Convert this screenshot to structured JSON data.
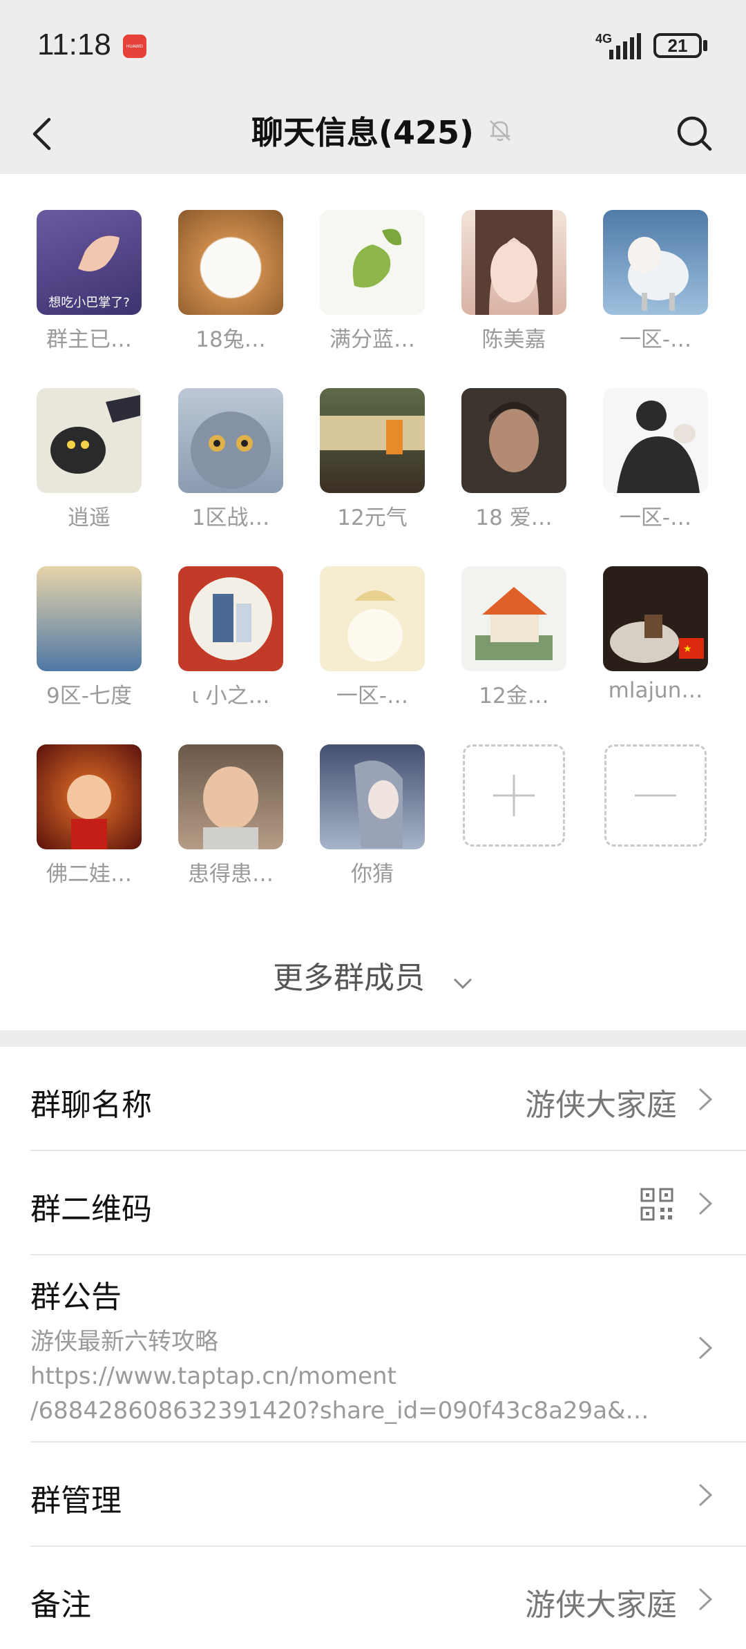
{
  "status_bar": {
    "time": "11:18",
    "app_badge": "HUAWEI",
    "network": "4G",
    "battery": "21"
  },
  "nav": {
    "title": "聊天信息(425)",
    "back_icon": "chevron-left-icon",
    "mute_icon": "bell-off-icon",
    "search_icon": "search-icon"
  },
  "members": [
    {
      "name": "群主已…",
      "avatar_color": "#5b4a8a",
      "avatar_caption": "想吃小巴掌了?"
    },
    {
      "name": "18兔…",
      "avatar_color": "#c4884a"
    },
    {
      "name": "满分蓝…",
      "avatar_color": "#f7f7f2"
    },
    {
      "name": "陈美嘉",
      "avatar_color": "#e9cfc4"
    },
    {
      "name": "一区-…",
      "avatar_color": "#7fa6c7"
    },
    {
      "name": "逍遥",
      "avatar_color": "#d9d4c6"
    },
    {
      "name": "1区战…",
      "avatar_color": "#8b9bb0"
    },
    {
      "name": "12元气",
      "avatar_color": "#6a5a40"
    },
    {
      "name": "18 爱…",
      "avatar_color": "#3c342e"
    },
    {
      "name": "一区-…",
      "avatar_color": "#f2f2f2"
    },
    {
      "name": "9区-七度",
      "avatar_color": "#b9c8d4"
    },
    {
      "name": "ι 小之…",
      "avatar_color": "#c23a28"
    },
    {
      "name": "一区-…",
      "avatar_color": "#f6ecd0"
    },
    {
      "name": "12金…",
      "avatar_color": "#e9ece6"
    },
    {
      "name": "mlajun…",
      "avatar_color": "#3a2a22"
    },
    {
      "name": "佛二娃…",
      "avatar_color": "#b3281e"
    },
    {
      "name": "患得患…",
      "avatar_color": "#8f7a6a"
    },
    {
      "name": "你猜",
      "avatar_color": "#7e8aa3"
    }
  ],
  "add_member_icon": "plus-icon",
  "remove_member_icon": "minus-icon",
  "more_members": "更多群成员",
  "settings": {
    "group_name_label": "群聊名称",
    "group_name_value": "游侠大家庭",
    "qr_label": "群二维码",
    "qr_icon": "qr-code-icon",
    "notice_label": "群公告",
    "notice_line1": "游侠最新六转攻略",
    "notice_line2": "https://www.taptap.cn/moment",
    "notice_line3": "/688428608632391420?share_id=090f43c8a29a&…",
    "manage_label": "群管理",
    "remark_label": "备注",
    "remark_value": "游侠大家庭"
  }
}
